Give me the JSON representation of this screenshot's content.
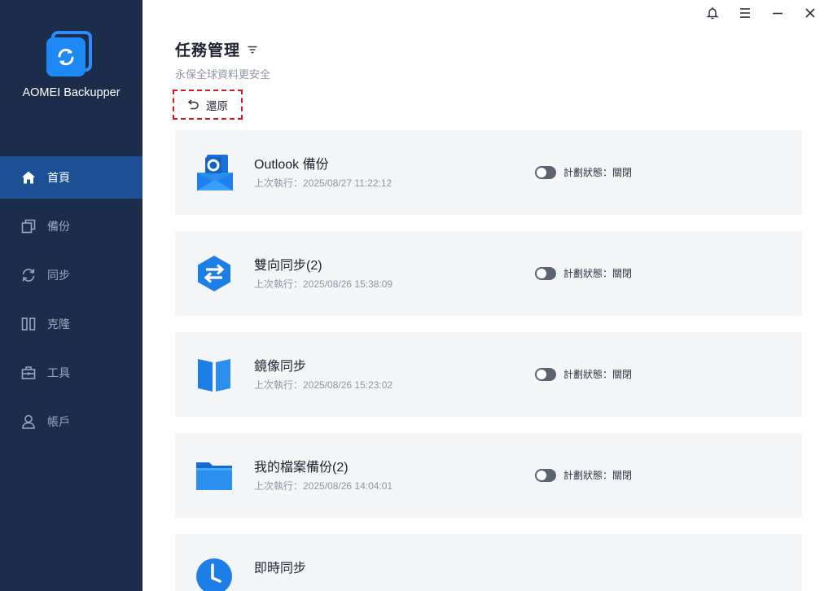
{
  "app": {
    "name": "AOMEI Backupper"
  },
  "nav": [
    {
      "key": "home",
      "label": "首頁",
      "icon": "home-icon",
      "active": true
    },
    {
      "key": "backup",
      "label": "備份",
      "icon": "backup-icon"
    },
    {
      "key": "sync",
      "label": "同步",
      "icon": "sync-icon"
    },
    {
      "key": "clone",
      "label": "克隆",
      "icon": "clone-icon"
    },
    {
      "key": "tools",
      "label": "工具",
      "icon": "toolbox-icon"
    },
    {
      "key": "account",
      "label": "帳戶",
      "icon": "user-icon"
    }
  ],
  "header": {
    "title": "任務管理",
    "subtitle": "永保全球資料更安全",
    "restore_label": "還原"
  },
  "tasks": [
    {
      "name": "Outlook 備份",
      "last_run": "上次執行：2025/08/27 11:22:12",
      "status": "計劃狀態：關閉",
      "icon": "outlook-icon"
    },
    {
      "name": "雙向同步(2)",
      "last_run": "上次執行：2025/08/26 15:38:09",
      "status": "計劃狀態：關閉",
      "icon": "two-way-sync-icon"
    },
    {
      "name": "鏡像同步",
      "last_run": "上次執行：2025/08/26 15:23:02",
      "status": "計劃狀態：關閉",
      "icon": "mirror-sync-icon"
    },
    {
      "name": "我的檔案備份(2)",
      "last_run": "上次執行：2025/08/26 14:04:01",
      "status": "計劃狀態：關閉",
      "icon": "folder-icon"
    },
    {
      "name": "即時同步",
      "last_run": "",
      "status": "",
      "icon": "realtime-sync-icon"
    }
  ],
  "colors": {
    "sidebar_bg": "#1c2d4c",
    "nav_active_bg": "#1c4f93",
    "accent": "#1e88f5",
    "card_bg": "#f4f5f7",
    "highlight_border": "#d9141b"
  }
}
